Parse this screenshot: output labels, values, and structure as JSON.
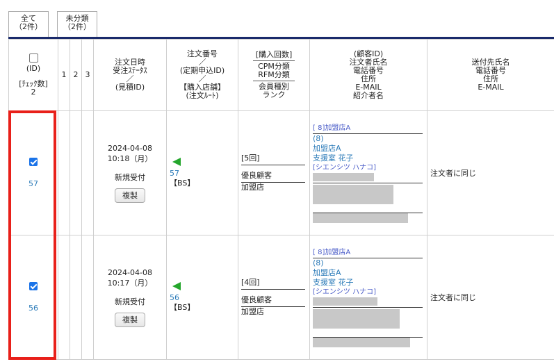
{
  "tabs": [
    {
      "label": "全て",
      "count": "（2件）"
    },
    {
      "label": "未分類",
      "count": "（2件）"
    }
  ],
  "header": {
    "id_label": "(ID)",
    "check_count_label": "[ﾁｪｯｸ数]",
    "check_count": "2",
    "col1": "1",
    "col2": "2",
    "col3": "3",
    "date_lines": [
      "注文日時",
      "受注ｽﾃｰﾀｽ",
      "／",
      "(見積ID)"
    ],
    "order_lines": [
      "注文番号",
      "／",
      "(定期申込ID)",
      "／",
      "【購入店舗】",
      "(注文ﾙｰﾄ)"
    ],
    "buy_lines": [
      "[購入回数]",
      "CPM分類",
      "RFM分類",
      "会員種別",
      "ランク"
    ],
    "cust_lines": [
      "(顧客ID)",
      "注文者氏名",
      "電話番号",
      "住所",
      "E-MAIL",
      "紹介者名"
    ],
    "ship_lines": [
      "送付先氏名",
      "電話番号",
      "住所",
      "E-MAIL"
    ]
  },
  "rows": [
    {
      "id": "57",
      "date": "2024-04-08",
      "time": "10:18（月）",
      "status": "新規受付",
      "copy_label": "複製",
      "order_no": "57",
      "route": "【BS】",
      "buy_count": "[5回]",
      "member_type": "優良顧客",
      "rank": "加盟店",
      "store": "[ 8]加盟店A",
      "cust_id": "(8)",
      "cust_store": "加盟店A",
      "cust_name": "支援室 花子",
      "cust_kana": "[シエンシツ ハナコ]",
      "ship": "注文者に同じ"
    },
    {
      "id": "56",
      "date": "2024-04-08",
      "time": "10:17（月）",
      "status": "新規受付",
      "copy_label": "複製",
      "order_no": "56",
      "route": "【BS】",
      "buy_count": "[4回]",
      "member_type": "優良顧客",
      "rank": "加盟店",
      "store": "[ 8]加盟店A",
      "cust_id": "(8)",
      "cust_store": "加盟店A",
      "cust_name": "支援室 花子",
      "cust_kana": "[シエンシツ ハナコ]",
      "ship": "注文者に同じ"
    }
  ],
  "colors": {
    "accent": "#1a2a6b",
    "link": "#2a7ab8",
    "highlight": "#e8201a",
    "flag": "#24a62c"
  }
}
